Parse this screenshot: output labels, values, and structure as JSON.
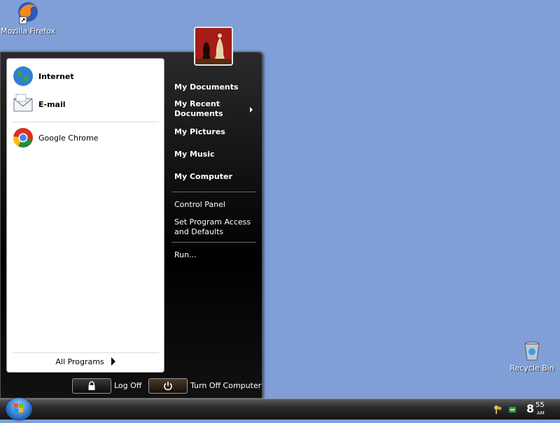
{
  "desktop": {
    "icons": [
      {
        "label": "Mozilla Firefox"
      },
      {
        "label": "Recycle Bin"
      }
    ]
  },
  "start_menu": {
    "pinned": [
      {
        "label": "Internet",
        "icon": "globe-icon"
      },
      {
        "label": "E-mail",
        "icon": "envelope-icon"
      }
    ],
    "recent": [
      {
        "label": "Google Chrome",
        "icon": "chrome-icon"
      }
    ],
    "all_programs": "All Programs",
    "places": [
      {
        "label": "My Documents"
      },
      {
        "label": "My Recent\nDocuments"
      },
      {
        "label": "My Pictures"
      },
      {
        "label": "My Music"
      },
      {
        "label": "My Computer"
      }
    ],
    "system": [
      {
        "label": "Control Panel"
      },
      {
        "label": "Set Program Access\nand Defaults"
      }
    ],
    "run": "Run...",
    "log_off": "Log Off",
    "turn_off": "Turn Off Computer"
  },
  "taskbar": {
    "clock_hour": "8",
    "clock_minute": "55",
    "clock_ampm": "AM"
  }
}
